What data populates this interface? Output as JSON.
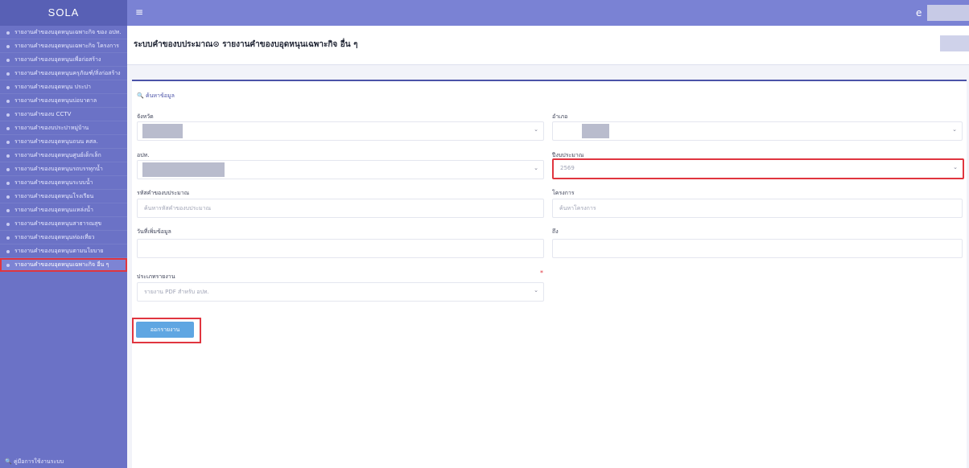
{
  "app": {
    "brand": "SOLA"
  },
  "topbar": {
    "menu_icon": "≡",
    "user_icon": "e"
  },
  "title": "ระบบคำของบประมาณ⊙ รายงานคำของบอุดหนุนเฉพาะกิจ อื่น ๆ",
  "sidebar": {
    "items": [
      {
        "label": "รายงานคำของบอุดหนุนเฉพาะกิจ ของ อปท."
      },
      {
        "label": "รายงานคำของบอุดหนุนเฉพาะกิจ โครงการ"
      },
      {
        "label": "รายงานคำของบอุดหนุนเพื่อก่อสร้าง"
      },
      {
        "label": "รายงานคำของบอุดหนุนครุภัณฑ์/สิ่งก่อสร้าง"
      },
      {
        "label": "รายงานคำของบอุดหนุน ประปา"
      },
      {
        "label": "รายงานคำของบอุดหนุนบ่อบาดาล"
      },
      {
        "label": "รายงานคำของบ CCTV"
      },
      {
        "label": "รายงานคำของบประปาหมู่บ้าน"
      },
      {
        "label": "รายงานคำของบอุดหนุนถนน คสล."
      },
      {
        "label": "รายงานคำของบอุดหนุนศูนย์เด็กเล็ก"
      },
      {
        "label": "รายงานคำของบอุดหนุนรถบรรทุกน้ำ"
      },
      {
        "label": "รายงานคำของบอุดหนุนระบบน้ำ"
      },
      {
        "label": "รายงานคำของบอุดหนุนโรงเรียน"
      },
      {
        "label": "รายงานคำของบอุดหนุนแหล่งน้ำ"
      },
      {
        "label": "รายงานคำของบอุดหนุนสาธารณสุข"
      },
      {
        "label": "รายงานคำของบอุดหนุนท่องเที่ยว"
      },
      {
        "label": "รายงานคำของบอุดหนุนตามนโยบาย"
      }
    ],
    "active_label": "รายงานคำของบอุดหนุนเฉพาะกิจ อื่น ๆ",
    "footer": "คู่มือการใช้งานระบบ"
  },
  "search": {
    "label": "ค้นหาข้อมูล"
  },
  "form": {
    "province_label": "จังหวัด",
    "district_label": "อำเภอ",
    "lao_label": "อปท.",
    "fiscal_year_label": "ปีงบประมาณ",
    "fiscal_year_value": "2569",
    "budget_code_label": "รหัสคำของบประมาณ",
    "budget_code_placeholder": "ค้นหารหัสคำของบประมาณ",
    "project_label": "โครงการ",
    "project_placeholder": "ค้นหาโครงการ",
    "date_label": "วันที่เพิ่มข้อมูล",
    "to_label": "ถึง",
    "report_type_label": "ประเภทรายงาน",
    "report_type_value": "รายงาน PDF สำหรับ อปท.",
    "submit_label": "ออกรายงาน"
  },
  "colors": {
    "sidebar": "#6b72c6",
    "topbar": "#7a82d4",
    "highlight": "#e0353f",
    "button": "#5fa6e2"
  }
}
